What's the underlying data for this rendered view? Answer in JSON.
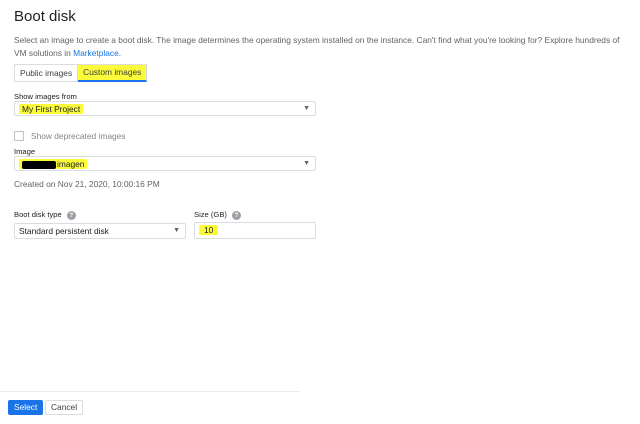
{
  "header": {
    "title": "Boot disk",
    "description_prefix": "Select an image to create a boot disk. The image determines the operating system installed on the instance. Can't find what you're looking for? Explore hundreds of VM solutions in ",
    "description_link": "Marketplace",
    "description_suffix": "."
  },
  "tabs": [
    {
      "label": "Public images",
      "active": false
    },
    {
      "label": "Custom images",
      "active": true
    }
  ],
  "show_images_from": {
    "label": "Show images from",
    "value": "My First Project"
  },
  "deprecated": {
    "label": "Show deprecated images",
    "checked": false
  },
  "image": {
    "label": "Image",
    "value_visible": "imagen",
    "created": "Created on Nov 21, 2020, 10:00:16 PM"
  },
  "boot_disk_type": {
    "label": "Boot disk type",
    "value": "Standard persistent disk",
    "help_icon": "?"
  },
  "size": {
    "label": "Size (GB)",
    "value": "10",
    "help_icon": "?"
  },
  "caret_glyph": "▼",
  "footer": {
    "select_label": "Select",
    "cancel_label": "Cancel"
  },
  "colors": {
    "highlight": "#fbfb3a",
    "primary": "#1a73e8",
    "link": "#1a73e8"
  }
}
